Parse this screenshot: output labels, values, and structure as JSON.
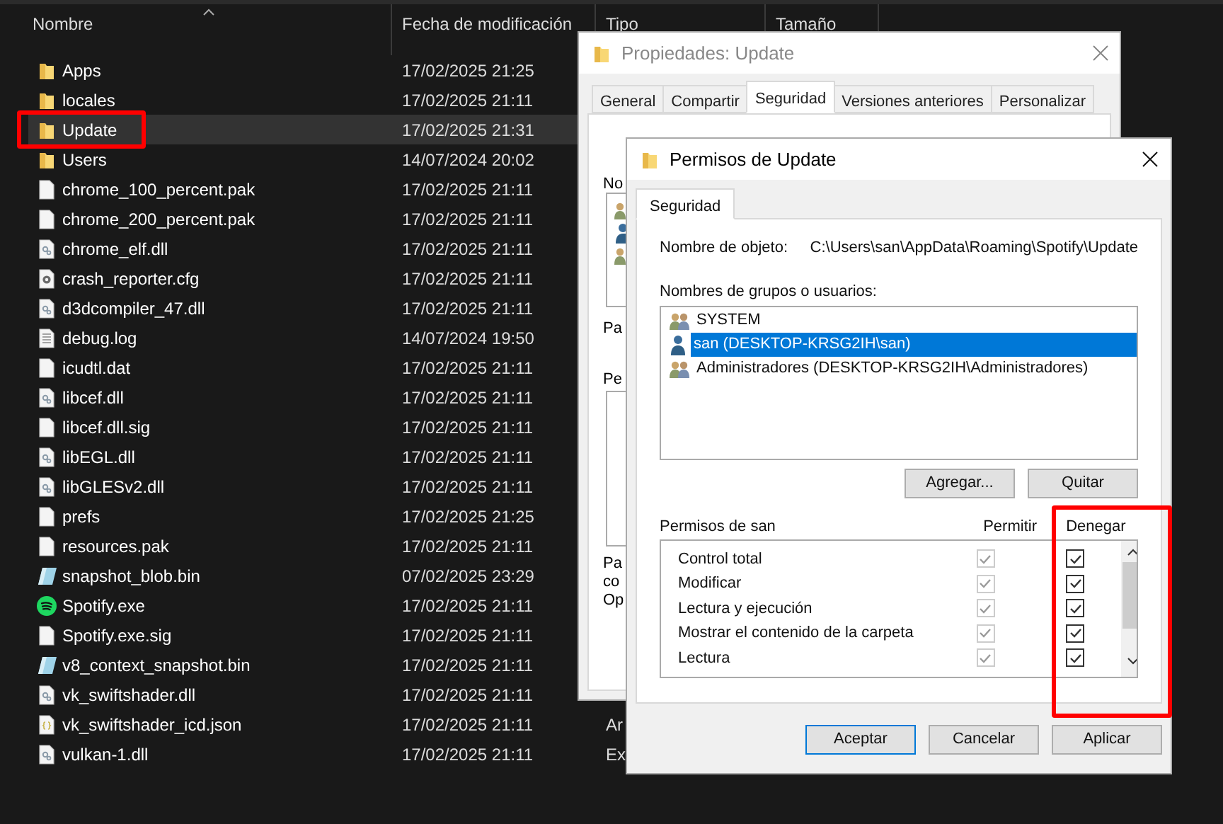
{
  "explorer": {
    "columns": [
      {
        "label": "Nombre",
        "sorted": true
      },
      {
        "label": "Fecha de modificación"
      },
      {
        "label": "Tipo"
      },
      {
        "label": "Tamaño"
      }
    ],
    "files": [
      {
        "name": "Apps",
        "date": "17/02/2025 21:25",
        "kind": "folder",
        "selected": false
      },
      {
        "name": "locales",
        "date": "17/02/2025 21:11",
        "kind": "folder",
        "selected": false
      },
      {
        "name": "Update",
        "date": "17/02/2025 21:31",
        "kind": "folder",
        "selected": true,
        "marked": true
      },
      {
        "name": "Users",
        "date": "14/07/2024 20:02",
        "kind": "folder",
        "selected": false
      },
      {
        "name": "chrome_100_percent.pak",
        "date": "17/02/2025 21:11",
        "kind": "file",
        "selected": false
      },
      {
        "name": "chrome_200_percent.pak",
        "date": "17/02/2025 21:11",
        "kind": "file",
        "selected": false
      },
      {
        "name": "chrome_elf.dll",
        "date": "17/02/2025 21:11",
        "kind": "dll",
        "selected": false
      },
      {
        "name": "crash_reporter.cfg",
        "date": "17/02/2025 21:11",
        "kind": "cfg",
        "selected": false
      },
      {
        "name": "d3dcompiler_47.dll",
        "date": "17/02/2025 21:11",
        "kind": "dll",
        "selected": false
      },
      {
        "name": "debug.log",
        "date": "14/07/2024 19:50",
        "kind": "log",
        "selected": false
      },
      {
        "name": "icudtl.dat",
        "date": "17/02/2025 21:11",
        "kind": "file",
        "selected": false
      },
      {
        "name": "libcef.dll",
        "date": "17/02/2025 21:11",
        "kind": "dll",
        "selected": false
      },
      {
        "name": "libcef.dll.sig",
        "date": "17/02/2025 21:11",
        "kind": "file",
        "selected": false
      },
      {
        "name": "libEGL.dll",
        "date": "17/02/2025 21:11",
        "kind": "dll",
        "selected": false
      },
      {
        "name": "libGLESv2.dll",
        "date": "17/02/2025 21:11",
        "kind": "dll",
        "selected": false
      },
      {
        "name": "prefs",
        "date": "17/02/2025 21:25",
        "kind": "file",
        "selected": false
      },
      {
        "name": "resources.pak",
        "date": "17/02/2025 21:11",
        "kind": "file",
        "selected": false
      },
      {
        "name": "snapshot_blob.bin",
        "date": "07/02/2025 23:29",
        "kind": "bin",
        "selected": false
      },
      {
        "name": "Spotify.exe",
        "date": "17/02/2025 21:11",
        "kind": "exe",
        "selected": false
      },
      {
        "name": "Spotify.exe.sig",
        "date": "17/02/2025 21:11",
        "kind": "file",
        "selected": false
      },
      {
        "name": "v8_context_snapshot.bin",
        "date": "17/02/2025 21:11",
        "kind": "bin",
        "selected": false
      },
      {
        "name": "vk_swiftshader.dll",
        "date": "17/02/2025 21:11",
        "kind": "dll",
        "selected": false
      },
      {
        "name": "vk_swiftshader_icd.json",
        "date": "17/02/2025 21:11",
        "kind": "json",
        "selected": false,
        "type": "Ar"
      },
      {
        "name": "vulkan-1.dll",
        "date": "17/02/2025 21:11",
        "kind": "dll",
        "selected": false,
        "type": "Ex"
      }
    ]
  },
  "properties_dialog": {
    "title": "Propiedades: Update",
    "tabs": [
      {
        "label": "General",
        "selected": false
      },
      {
        "label": "Compartir",
        "selected": false
      },
      {
        "label": "Seguridad",
        "selected": true
      },
      {
        "label": "Versiones anteriores",
        "selected": false
      },
      {
        "label": "Personalizar",
        "selected": false
      }
    ],
    "fragments": [
      "No",
      "Pa",
      "Pe",
      "Pa",
      "co",
      "Op"
    ]
  },
  "permissions_dialog": {
    "title": "Permisos de Update",
    "tab": "Seguridad",
    "object_label": "Nombre de objeto:",
    "object_path": "C:\\Users\\san\\AppData\\Roaming\\Spotify\\Update",
    "users_label": "Nombres de grupos o usuarios:",
    "users": [
      {
        "name": "SYSTEM",
        "kind": "group",
        "selected": false
      },
      {
        "name": "san (DESKTOP-KRSG2IH\\san)",
        "kind": "user",
        "selected": true
      },
      {
        "name": "Administradores (DESKTOP-KRSG2IH\\Administradores)",
        "kind": "group",
        "selected": false
      }
    ],
    "user_buttons": [
      "Agregar...",
      "Quitar"
    ],
    "permissions_label": "Permisos de san",
    "allow_label": "Permitir",
    "deny_label": "Denegar",
    "deny_marked": true,
    "permissions": [
      {
        "name": "Control total",
        "allow": true,
        "allow_disabled": true,
        "deny": true
      },
      {
        "name": "Modificar",
        "allow": true,
        "allow_disabled": true,
        "deny": true
      },
      {
        "name": "Lectura y ejecución",
        "allow": true,
        "allow_disabled": true,
        "deny": true
      },
      {
        "name": "Mostrar el contenido de la carpeta",
        "allow": true,
        "allow_disabled": true,
        "deny": true
      },
      {
        "name": "Lectura",
        "allow": true,
        "allow_disabled": true,
        "deny": true
      }
    ],
    "buttons": [
      {
        "label": "Aceptar",
        "default": true
      },
      {
        "label": "Cancelar",
        "default": false
      },
      {
        "label": "Aplicar",
        "default": false
      }
    ]
  }
}
